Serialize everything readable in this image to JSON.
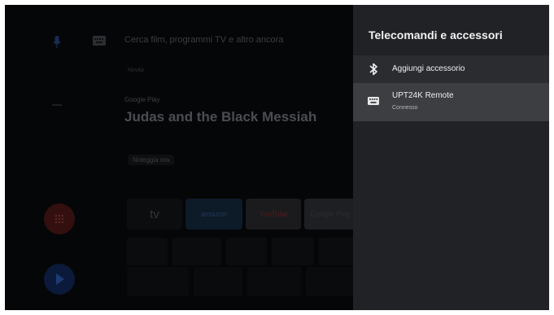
{
  "home": {
    "search_placeholder": "Cerca film, programmi TV e altro ancora",
    "row_label": "Novità",
    "featured": {
      "source": "Google Play",
      "title": "Judas and the Black Messiah",
      "subtitle": "",
      "cta": "Noleggia ora"
    },
    "apps": [
      "tv",
      "amazon",
      "YouTube",
      "Google Play"
    ]
  },
  "panel": {
    "title": "Telecomandi e accessori",
    "items": [
      {
        "label": "Aggiungi accessorio",
        "icon": "bluetooth-icon"
      },
      {
        "label": "UPT24K Remote",
        "status": "Connesso",
        "icon": "keyboard-icon"
      }
    ]
  },
  "colors": {
    "panel_bg": "#202226",
    "selected_bg": "#3c3e42",
    "text": "#eeeeee"
  }
}
